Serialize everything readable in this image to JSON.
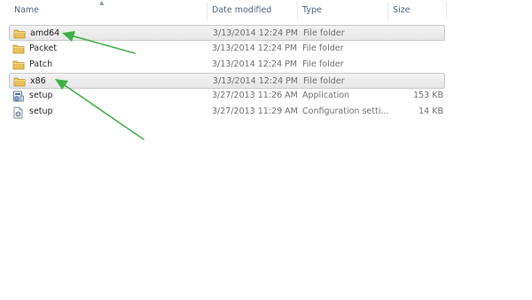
{
  "columns": {
    "name": "Name",
    "date": "Date modified",
    "type": "Type",
    "size": "Size"
  },
  "files": [
    {
      "name": "amd64",
      "date": "3/13/2014 12:24 PM",
      "type": "File folder",
      "size": "",
      "icon": "folder-icon",
      "selected": true
    },
    {
      "name": "Packet",
      "date": "3/13/2014 12:24 PM",
      "type": "File folder",
      "size": "",
      "icon": "folder-icon",
      "selected": false
    },
    {
      "name": "Patch",
      "date": "3/13/2014 12:24 PM",
      "type": "File folder",
      "size": "",
      "icon": "folder-icon",
      "selected": false
    },
    {
      "name": "x86",
      "date": "3/13/2014 12:24 PM",
      "type": "File folder",
      "size": "",
      "icon": "folder-icon",
      "selected": true
    },
    {
      "name": "setup",
      "date": "3/27/2013 11:26 AM",
      "type": "Application",
      "size": "153 KB",
      "icon": "application-icon",
      "selected": false
    },
    {
      "name": "setup",
      "date": "3/27/2013 11:29 AM",
      "type": "Configuration setti...",
      "size": "14 KB",
      "icon": "config-file-icon",
      "selected": false
    }
  ],
  "colors": {
    "arrow": "#3fae49",
    "folder": "#e8c15a",
    "selection": "#e8e8e8",
    "header_text": "#4c607a"
  }
}
